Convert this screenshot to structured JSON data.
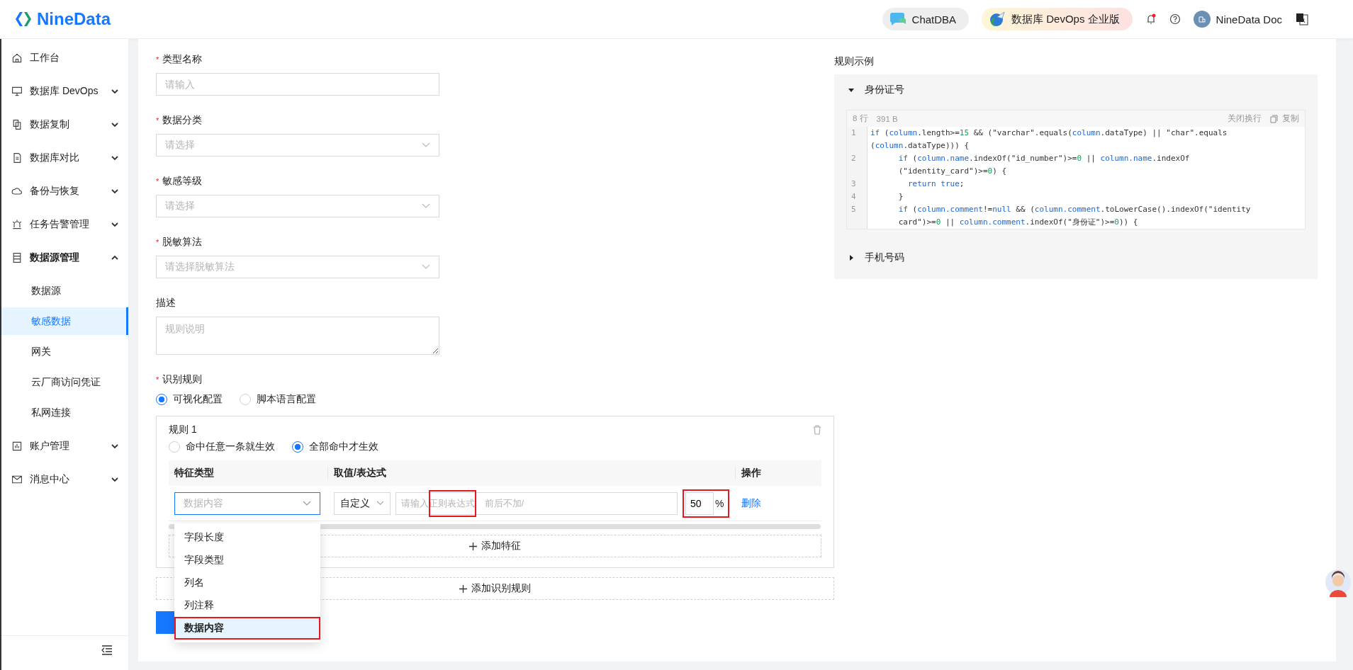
{
  "header": {
    "logo": "NineData",
    "chat_button": "ChatDBA",
    "edition_button": "数据库 DevOps 企业版",
    "unread_notifications": true,
    "user_name": "NineData Doc"
  },
  "sidebar": {
    "items": [
      {
        "label": "工作台",
        "selected": false
      },
      {
        "label": "数据库 DevOps",
        "selected": false,
        "expanded": false
      },
      {
        "label": "数据复制",
        "selected": false,
        "expanded": false
      },
      {
        "label": "数据库对比",
        "selected": false,
        "expanded": false
      },
      {
        "label": "备份与恢复",
        "selected": false,
        "expanded": false
      },
      {
        "label": "任务告警管理",
        "selected": false,
        "expanded": false
      },
      {
        "label": "数据源管理",
        "selected": false,
        "expanded": true,
        "children": [
          {
            "label": "数据源",
            "selected": false
          },
          {
            "label": "敏感数据",
            "selected": true
          },
          {
            "label": "网关",
            "selected": false
          },
          {
            "label": "云厂商访问凭证",
            "selected": false
          },
          {
            "label": "私网连接",
            "selected": false
          }
        ]
      },
      {
        "label": "账户管理",
        "selected": false,
        "expanded": false
      },
      {
        "label": "消息中心",
        "selected": false,
        "expanded": false
      }
    ]
  },
  "form": {
    "fields": [
      {
        "label": "类型名称",
        "required_mark": "*",
        "kind": "input",
        "placeholder": "请输入"
      },
      {
        "label": "数据分类",
        "required_mark": "*",
        "kind": "select",
        "placeholder": "请选择"
      },
      {
        "label": "敏感等级",
        "required_mark": "*",
        "kind": "select",
        "placeholder": "请选择"
      },
      {
        "label": "脱敏算法",
        "required_mark": "*",
        "kind": "select",
        "placeholder": "请选择脱敏算法"
      },
      {
        "label": "描述",
        "kind": "textarea",
        "placeholder": "规则说明"
      }
    ],
    "recognition": {
      "label": "识别规则",
      "required_mark": "*",
      "modes": [
        {
          "label": "可视化配置",
          "selected": true
        },
        {
          "label": "脚本语言配置",
          "selected": false
        }
      ],
      "rules": [
        {
          "title": "规则 1",
          "match_modes": [
            {
              "label": "命中任意一条就生效",
              "selected": false
            },
            {
              "label": "全部命中才生效",
              "selected": true
            }
          ],
          "columns": [
            "特征类型",
            "取值/表达式",
            "操作"
          ],
          "rows": [
            {
              "feature_type": {
                "placeholder": "数据内容",
                "open": true,
                "options": [
                  {
                    "label": "字段长度",
                    "selected": false,
                    "annotated": false
                  },
                  {
                    "label": "字段类型",
                    "selected": false,
                    "annotated": false
                  },
                  {
                    "label": "列名",
                    "selected": false,
                    "annotated": false
                  },
                  {
                    "label": "列注释",
                    "selected": false,
                    "annotated": false
                  },
                  {
                    "label": "数据内容",
                    "selected": true,
                    "annotated": true
                  }
                ]
              },
              "mode": "自定义",
              "expression": {
                "placeholder": "请输入正则表达式 前后不加/",
                "annotated": true
              },
              "percent": {
                "value": "50",
                "unit": "%",
                "annotated": true
              },
              "action": "删除"
            }
          ],
          "add_feature": "添加特征"
        }
      ],
      "add_rule": "添加识别规则"
    }
  },
  "examples": {
    "title": "规则示例",
    "items": [
      {
        "title": "身份证号",
        "expanded": true,
        "code": {
          "line_count": "8 行",
          "size": "391 B",
          "wrap_toggle": "关闭换行",
          "copy": "复制",
          "lines": [
            {
              "number": "1",
              "segs": [
                {
                  "text": "if",
                  "kind": "kw"
                },
                {
                  "text": " (",
                  "kind": "plain"
                },
                {
                  "text": "column",
                  "kind": "kw"
                },
                {
                  "text": ".length>=",
                  "kind": "plain"
                },
                {
                  "text": "15",
                  "kind": "num"
                },
                {
                  "text": " && (\"varchar\".equals(",
                  "kind": "plain"
                },
                {
                  "text": "column",
                  "kind": "kw"
                },
                {
                  "text": ".dataType) || \"char\".equals",
                  "kind": "plain"
                }
              ]
            },
            {
              "segs": [
                {
                  "text": "(",
                  "kind": "plain"
                },
                {
                  "text": "column",
                  "kind": "kw"
                },
                {
                  "text": ".dataType))) {",
                  "kind": "plain"
                }
              ]
            },
            {
              "number": "2",
              "segs": [
                {
                  "text": "      if",
                  "kind": "kw"
                },
                {
                  "text": " (",
                  "kind": "plain"
                },
                {
                  "text": "column.name",
                  "kind": "kw"
                },
                {
                  "text": ".indexOf(\"id_number\")>=",
                  "kind": "plain"
                },
                {
                  "text": "0",
                  "kind": "num"
                },
                {
                  "text": " || ",
                  "kind": "plain"
                },
                {
                  "text": "column.name",
                  "kind": "kw"
                },
                {
                  "text": ".indexOf",
                  "kind": "plain"
                }
              ]
            },
            {
              "segs": [
                {
                  "text": "      (\"identity_card\")>=",
                  "kind": "plain"
                },
                {
                  "text": "0",
                  "kind": "num"
                },
                {
                  "text": ") {",
                  "kind": "plain"
                }
              ]
            },
            {
              "number": "3",
              "segs": [
                {
                  "text": "        return true",
                  "kind": "kw"
                },
                {
                  "text": ";",
                  "kind": "plain"
                }
              ]
            },
            {
              "number": "4",
              "segs": [
                {
                  "text": "      }",
                  "kind": "plain"
                }
              ]
            },
            {
              "number": "5",
              "segs": [
                {
                  "text": "      if",
                  "kind": "kw"
                },
                {
                  "text": " (",
                  "kind": "plain"
                },
                {
                  "text": "column.comment",
                  "kind": "kw"
                },
                {
                  "text": "!=",
                  "kind": "plain"
                },
                {
                  "text": "null",
                  "kind": "kw"
                },
                {
                  "text": " && (",
                  "kind": "plain"
                },
                {
                  "text": "column.comment",
                  "kind": "kw"
                },
                {
                  "text": ".toLowerCase().indexOf(\"identity",
                  "kind": "plain"
                }
              ]
            },
            {
              "segs": [
                {
                  "text": "      card\")>=",
                  "kind": "plain"
                },
                {
                  "text": "0",
                  "kind": "num"
                },
                {
                  "text": " || ",
                  "kind": "plain"
                },
                {
                  "text": "column.comment",
                  "kind": "kw"
                },
                {
                  "text": ".indexOf(\"身份证\")>=",
                  "kind": "plain"
                },
                {
                  "text": "0",
                  "kind": "num"
                },
                {
                  "text": ")) {",
                  "kind": "plain"
                }
              ]
            }
          ]
        }
      },
      {
        "title": "手机号码",
        "expanded": false
      }
    ]
  }
}
